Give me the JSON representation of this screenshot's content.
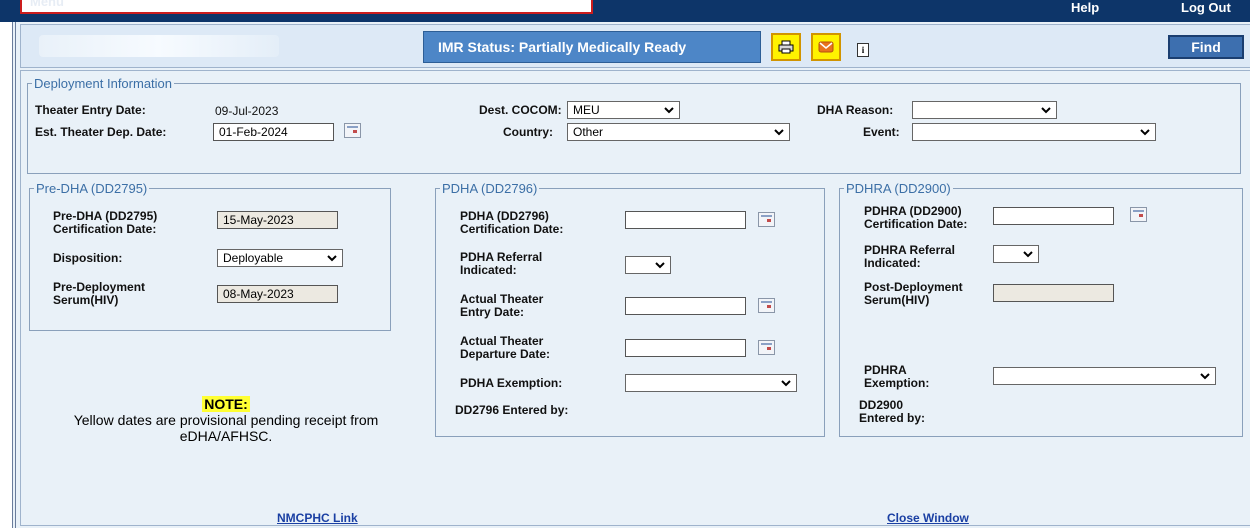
{
  "topbar": {
    "menu": "Menu",
    "help": "Help",
    "logout": "Log Out"
  },
  "status": {
    "imr": "IMR Status: Partially Medically Ready",
    "find": "Find",
    "print_icon": "print-icon",
    "email_icon": "mail-icon",
    "info_icon": "info-icon"
  },
  "deployment": {
    "legend": "Deployment Information",
    "theater_entry_label": "Theater Entry Date:",
    "theater_entry_value": "09-Jul-2023",
    "est_dep_label": "Est. Theater Dep. Date:",
    "est_dep_value": "01-Feb-2024",
    "cocom_label": "Dest. COCOM:",
    "cocom_value": "MEU",
    "country_label": "Country:",
    "country_value": "Other",
    "dha_reason_label": "DHA Reason:",
    "dha_reason_value": "",
    "event_label": "Event:",
    "event_value": ""
  },
  "predha": {
    "legend": "Pre-DHA (DD2795)",
    "cert_label_1": "Pre-DHA (DD2795)",
    "cert_label_2": "Certification Date:",
    "cert_value": "15-May-2023",
    "disp_label": "Disposition:",
    "disp_value": "Deployable",
    "serum_label_1": "Pre-Deployment",
    "serum_label_2": "Serum(HIV)",
    "serum_value": "08-May-2023"
  },
  "pdha": {
    "legend": "PDHA (DD2796)",
    "cert_label_1": "PDHA (DD2796)",
    "cert_label_2": "Certification Date:",
    "cert_value": "",
    "referral_label_1": "PDHA Referral",
    "referral_label_2": "Indicated:",
    "referral_value": "",
    "entry_label_1": "Actual Theater",
    "entry_label_2": "Entry Date:",
    "entry_value": "",
    "dep_label_1": "Actual Theater",
    "dep_label_2": "Departure Date:",
    "dep_value": "",
    "exemption_label": "PDHA Exemption:",
    "exemption_value": "",
    "entered_label": "DD2796 Entered by:"
  },
  "pdhra": {
    "legend": "PDHRA (DD2900)",
    "cert_label_1": "PDHRA (DD2900)",
    "cert_label_2": "Certification Date:",
    "cert_value": "",
    "referral_label_1": "PDHRA Referral",
    "referral_label_2": "Indicated:",
    "referral_value": "",
    "serum_label_1": "Post-Deployment",
    "serum_label_2": "Serum(HIV)",
    "serum_value": "",
    "exemption_label_1": "PDHRA",
    "exemption_label_2": "Exemption:",
    "exemption_value": "",
    "entered_label_1": "DD2900",
    "entered_label_2": "Entered by:"
  },
  "note": {
    "title": "NOTE:",
    "line1": "Yellow dates are provisional pending receipt from",
    "line2": "eDHA/AFHSC."
  },
  "footer": {
    "nmcphc": "NMCPHC Link",
    "close": "Close Window"
  }
}
